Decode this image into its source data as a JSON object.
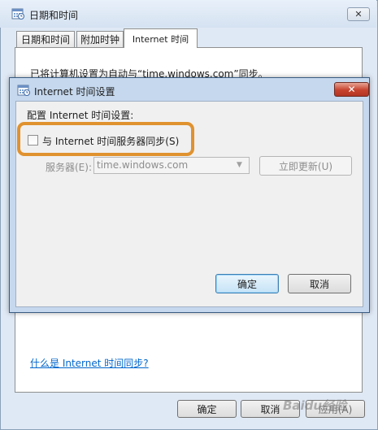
{
  "outer_window": {
    "title": "日期和时间",
    "close_glyph": "✕",
    "tabs": [
      {
        "label": "日期和时间"
      },
      {
        "label": "附加时钟"
      },
      {
        "label": "Internet 时间"
      }
    ],
    "sync_status": "已将计算机设置为自动与“time.windows.com”同步。",
    "help_link": "什么是 Internet 时间同步?",
    "buttons": {
      "ok": "确定",
      "cancel": "取消",
      "apply": "应用(A)"
    },
    "watermark": "Baidu经验"
  },
  "dialog": {
    "title": "Internet 时间设置",
    "close_glyph": "✕",
    "config_label": "配置 Internet 时间设置:",
    "sync_checkbox": {
      "label": "与 Internet 时间服务器同步(S)",
      "checked": false
    },
    "server_label": "服务器(E):",
    "server_value": "time.windows.com",
    "server_arrow": "▼",
    "update_button": "立即更新(U)",
    "ok_button": "确定",
    "cancel_button": "取消"
  },
  "colors": {
    "highlight": "#e0922f",
    "link": "#0066cc",
    "dialog_close": "#c7432f"
  },
  "icons": {
    "window_icon": "calendar-clock-icon"
  }
}
